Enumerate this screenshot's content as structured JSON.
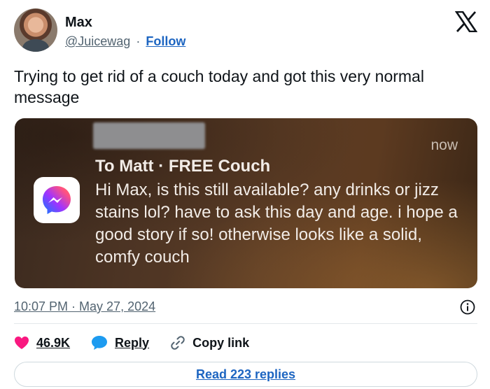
{
  "author": {
    "name": "Max",
    "handle": "@Juicewag",
    "separator": "·",
    "follow_label": "Follow",
    "avatar_icon": "avatar-photo"
  },
  "header": {
    "logo_icon": "x-logo-icon"
  },
  "tweet": {
    "text": "Trying to get rid of a couch today and got this very normal message"
  },
  "media": {
    "notification": {
      "app_icon": "messenger-icon",
      "time": "now",
      "title": "To Matt · FREE Couch",
      "body": "Hi Max, is this still available? any drinks or jizz stains lol? have to ask this day and age. i hope a good story if so! otherwise looks like a solid, comfy  couch"
    }
  },
  "meta": {
    "timestamp": "10:07 PM · May 27, 2024",
    "info_icon": "info-icon"
  },
  "actions": {
    "likes_count": "46.9K",
    "reply_label": "Reply",
    "copy_link_label": "Copy link"
  },
  "footer": {
    "read_replies_label": "Read 223 replies"
  },
  "colors": {
    "accent": "#1d65c1",
    "like": "#f91880",
    "reply_bubble": "#1d9bf0",
    "secondary_text": "#536471"
  }
}
